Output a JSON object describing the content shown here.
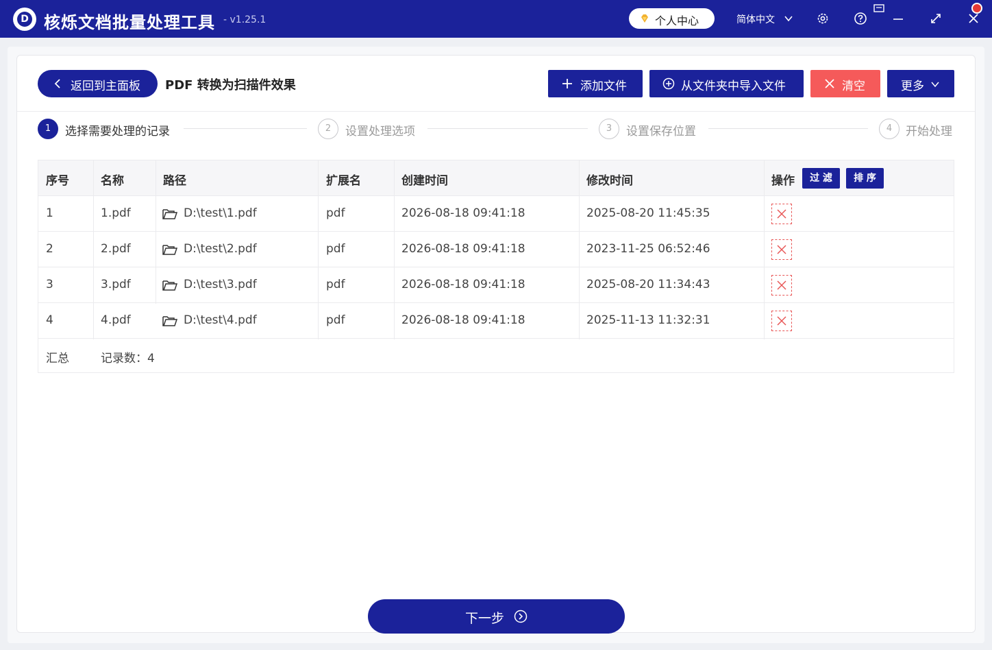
{
  "app": {
    "title": "核烁文档批量处理工具",
    "version": "- v1.25.1",
    "logo_letter": "D",
    "user_center": "个人中心",
    "language": "简体中文"
  },
  "toolbar": {
    "back": "返回到主面板",
    "page_title": "PDF 转换为扫描件效果",
    "add_file": "添加文件",
    "import_folder": "从文件夹中导入文件",
    "clear": "清空",
    "more": "更多"
  },
  "steps": [
    {
      "num": "1",
      "label": "选择需要处理的记录"
    },
    {
      "num": "2",
      "label": "设置处理选项"
    },
    {
      "num": "3",
      "label": "设置保存位置"
    },
    {
      "num": "4",
      "label": "开始处理"
    }
  ],
  "table": {
    "headers": {
      "index": "序号",
      "name": "名称",
      "path": "路径",
      "ext": "扩展名",
      "created": "创建时间",
      "modified": "修改时间",
      "actions": "操作"
    },
    "filter": "过 滤",
    "sort": "排 序",
    "rows": [
      {
        "index": "1",
        "name": "1.pdf",
        "path": "D:\\test\\1.pdf",
        "ext": "pdf",
        "created": "2026-08-18 09:41:18",
        "modified": "2025-08-20 11:45:35"
      },
      {
        "index": "2",
        "name": "2.pdf",
        "path": "D:\\test\\2.pdf",
        "ext": "pdf",
        "created": "2026-08-18 09:41:18",
        "modified": "2023-11-25 06:52:46"
      },
      {
        "index": "3",
        "name": "3.pdf",
        "path": "D:\\test\\3.pdf",
        "ext": "pdf",
        "created": "2026-08-18 09:41:18",
        "modified": "2025-08-20 11:34:43"
      },
      {
        "index": "4",
        "name": "4.pdf",
        "path": "D:\\test\\4.pdf",
        "ext": "pdf",
        "created": "2026-08-18 09:41:18",
        "modified": "2025-11-13 11:32:31"
      }
    ],
    "summary_label": "汇总",
    "summary_value": "记录数：4"
  },
  "footer": {
    "next": "下一步"
  },
  "colors": {
    "primary": "#1b229a",
    "danger": "#f55a5a",
    "active_step": "#1b229a"
  },
  "icons": [
    "logo-icon",
    "diamond-icon",
    "chevron-down-icon",
    "settings-icon",
    "help-icon",
    "minimize-icon",
    "maximize-icon",
    "close-icon",
    "notification-icon",
    "chevron-left-icon",
    "plus-icon",
    "add-circle-icon",
    "close-x-icon",
    "folder-icon",
    "delete-icon",
    "arrow-right-circle-icon"
  ]
}
